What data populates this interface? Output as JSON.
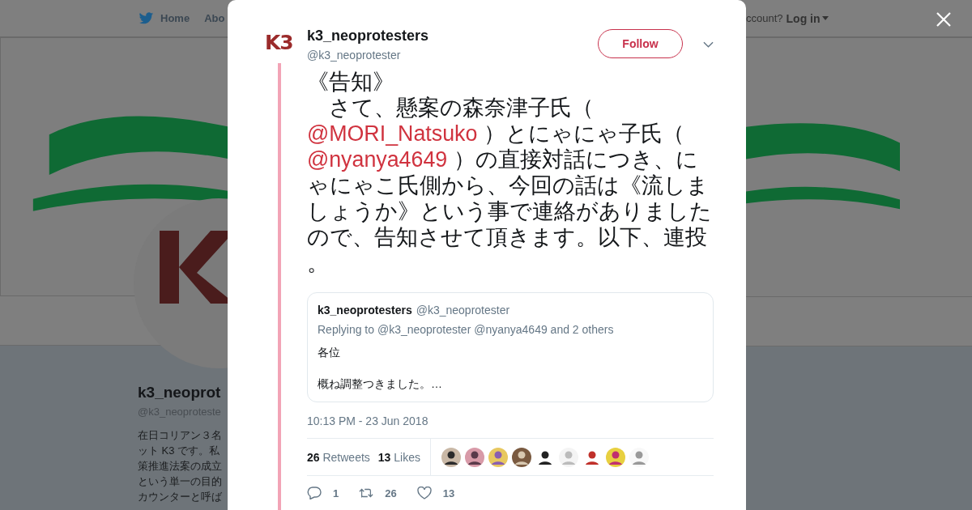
{
  "nav": {
    "items": [
      {
        "label": "Home",
        "kind": "home"
      },
      {
        "label": "Abo",
        "kind": "plain"
      }
    ],
    "account_prompt": "ccount?",
    "login": "Log in"
  },
  "profile": {
    "name": "k3_neoprot",
    "handle": "@k3_neoproteste",
    "bio": [
      "在日コリアン３名",
      "ット K3 です。私",
      "策推進法案の成立",
      "という単一の目的",
      "カウンターと呼ば"
    ]
  },
  "tweet": {
    "avatar_logo": "K3",
    "name": "k3_neoprotesters",
    "handle": "@k3_neoprotester",
    "follow": "Follow",
    "text": [
      {
        "kind": "line",
        "text": "《告知》"
      },
      {
        "kind": "text",
        "text": "　さて、懸案の森奈津子氏（"
      },
      {
        "kind": "mention",
        "text": "@MORI_Natsuko"
      },
      {
        "kind": "text",
        "text": " ）とにゃにゃ子氏（"
      },
      {
        "kind": "mention",
        "text": "@nyanya4649"
      },
      {
        "kind": "text",
        "text": " ）の直接対話につき、にゃにゃこ氏側から、今回の話は《流しましょうか》という事で連絡がありましたので、告知させて頂きます。以下、連投。"
      }
    ],
    "quote": {
      "name": "k3_neoprotesters",
      "handle": "@k3_neoprotester",
      "replying": "Replying to @k3_neoprotester @nyanya4649 and 2 others",
      "lines": [
        "各位",
        "概ね調整つきました。…"
      ]
    },
    "timestamp": "10:13 PM - 23 Jun 2018",
    "stats": [
      {
        "count": "26",
        "label": "Retweets"
      },
      {
        "count": "13",
        "label": "Likes"
      }
    ],
    "actions": [
      {
        "kind": "reply",
        "count": "1"
      },
      {
        "kind": "retweet",
        "count": "26"
      },
      {
        "kind": "like",
        "count": "13"
      }
    ]
  }
}
